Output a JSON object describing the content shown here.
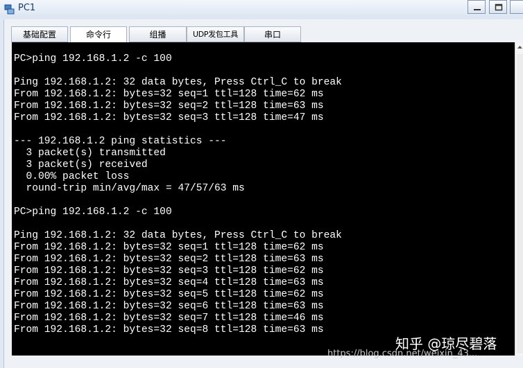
{
  "window": {
    "title": "PC1"
  },
  "tabs": [
    {
      "label": "基础配置"
    },
    {
      "label": "命令行"
    },
    {
      "label": "组播"
    },
    {
      "label": "UDP发包工具"
    },
    {
      "label": "串口"
    }
  ],
  "terminal": {
    "lines": [
      "PC>ping 192.168.1.2 -c 100",
      "",
      "Ping 192.168.1.2: 32 data bytes, Press Ctrl_C to break",
      "From 192.168.1.2: bytes=32 seq=1 ttl=128 time=62 ms",
      "From 192.168.1.2: bytes=32 seq=2 ttl=128 time=63 ms",
      "From 192.168.1.2: bytes=32 seq=3 ttl=128 time=47 ms",
      "",
      "--- 192.168.1.2 ping statistics ---",
      "  3 packet(s) transmitted",
      "  3 packet(s) received",
      "  0.00% packet loss",
      "  round-trip min/avg/max = 47/57/63 ms",
      "",
      "PC>ping 192.168.1.2 -c 100",
      "",
      "Ping 192.168.1.2: 32 data bytes, Press Ctrl_C to break",
      "From 192.168.1.2: bytes=32 seq=1 ttl=128 time=62 ms",
      "From 192.168.1.2: bytes=32 seq=2 ttl=128 time=63 ms",
      "From 192.168.1.2: bytes=32 seq=3 ttl=128 time=62 ms",
      "From 192.168.1.2: bytes=32 seq=4 ttl=128 time=63 ms",
      "From 192.168.1.2: bytes=32 seq=5 ttl=128 time=62 ms",
      "From 192.168.1.2: bytes=32 seq=6 ttl=128 time=63 ms",
      "From 192.168.1.2: bytes=32 seq=7 ttl=128 time=46 ms",
      "From 192.168.1.2: bytes=32 seq=8 ttl=128 time=63 ms"
    ]
  },
  "watermark": {
    "text": "知乎 @琼尽碧落",
    "url": "https://blog.csdn.net/weixin_43..."
  }
}
